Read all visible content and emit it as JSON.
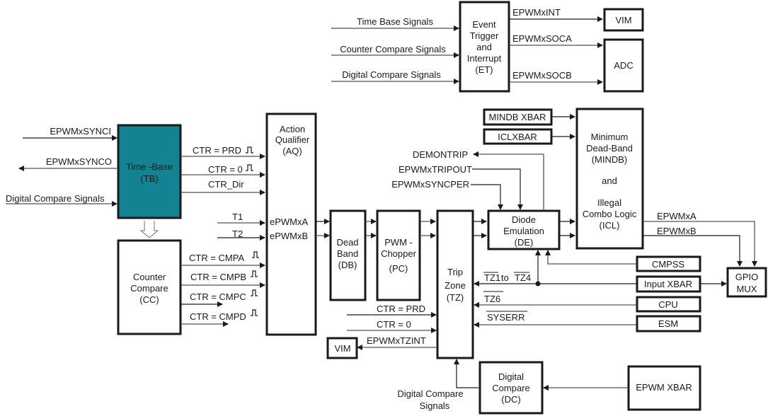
{
  "blocks": {
    "et": [
      "Event",
      "Trigger",
      "and",
      "Interrupt",
      "(ET)"
    ],
    "vim_top": "VIM",
    "adc": "ADC",
    "tb": [
      "Time -Base",
      "(TB)"
    ],
    "cc": [
      "Counter",
      "Compare",
      "(CC)"
    ],
    "aq": [
      "Action",
      "Qualifier",
      "(AQ)"
    ],
    "db": [
      "Dead",
      "Band",
      "(DB)"
    ],
    "pc": [
      "PWM -",
      "Chopper",
      "(PC)"
    ],
    "tz": [
      "Trip",
      "Zone",
      "(TZ)"
    ],
    "de": [
      "Diode",
      "Emulation",
      "(DE)"
    ],
    "mindb": [
      "Minimum",
      "Dead-Band",
      "(MINDB)",
      "and",
      "Illegal",
      "Combo Logic",
      "(ICL)"
    ],
    "mindb_xbar": "MINDB XBAR",
    "icl_xbar": "ICLXBAR",
    "cmpss": "CMPSS",
    "input_xbar": "Input XBAR",
    "cpu": "CPU",
    "esm": "ESM",
    "gpio": [
      "GPIO",
      "MUX"
    ],
    "vim_bottom": "VIM",
    "dc": [
      "Digital",
      "Compare",
      "(DC)"
    ],
    "epwm_xbar": "EPWM XBAR"
  },
  "signals": {
    "et_inputs": [
      "Time Base Signals",
      "Counter Compare Signals",
      "Digital Compare Signals"
    ],
    "et_outputs": [
      "EPWMxINT",
      "EPWMxSOCA",
      "EPWMxSOCB"
    ],
    "tb_synci": "EPWMxSYNCI",
    "tb_synco": "EPWMxSYNCO",
    "tb_dcs": "Digital Compare Signals",
    "tb_outputs": [
      "CTR =  PRD",
      "CTR = 0",
      "CTR_Dir"
    ],
    "t1": "T1",
    "t2": "T2",
    "aq_outputs": [
      "ePWMxA",
      "ePWMxB"
    ],
    "cc_outputs": [
      "CTR =  CMPA",
      "CTR =  CMPB",
      "CTR =  CMPC",
      "CTR =  CMPD"
    ],
    "de_signals": [
      "DEMONTRIP",
      "EPWMxTRIPOUT",
      "EPWMxSYNCPER"
    ],
    "icl_outputs": [
      "EPWMxA",
      "EPWMxB"
    ],
    "tz_inputs": [
      "TZ1",
      "to",
      "TZ4",
      "TZ6",
      "SYSERR"
    ],
    "tz_ctr": [
      "CTR = PRD",
      "CTR = 0"
    ],
    "tzint": "EPWMxTZINT",
    "dc_signals": [
      "Digital Compare",
      "Signals"
    ]
  },
  "colors": {
    "time_base_fill": "#138391"
  }
}
